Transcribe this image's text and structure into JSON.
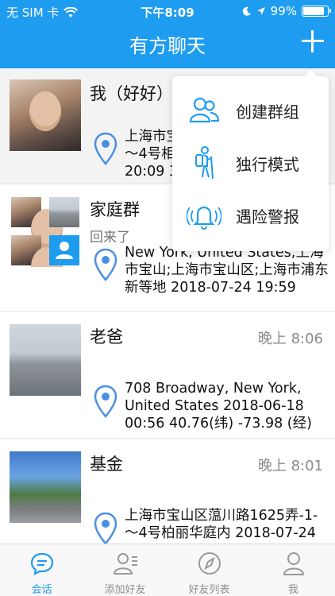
{
  "status_bar": {
    "carrier": "无 SIM 卡",
    "time": "下午8:09",
    "battery": "99%"
  },
  "nav": {
    "title": "有方聊天"
  },
  "menu": {
    "items": [
      {
        "label": "创建群组",
        "icon": "group-icon"
      },
      {
        "label": "独行模式",
        "icon": "hiker-icon"
      },
      {
        "label": "遇险警报",
        "icon": "alarm-bell-icon"
      }
    ]
  },
  "chats": [
    {
      "name": "我（好好）",
      "time": "",
      "subtitle": "",
      "location": "上海市宝\n～4号相\n20:09 3"
    },
    {
      "name": "家庭群",
      "time": "",
      "subtitle": "回来了",
      "location": " New York, United States;上海市宝山;上海市宝山区;上海市浦东新等地 2018-07-24 19:59"
    },
    {
      "name": "老爸",
      "time": "晚上 8:06",
      "subtitle": "",
      "location": "708 Broadway, New York, United States 2018-06-18 00:56 40.76(纬) -73.98 (经)"
    },
    {
      "name": "基金",
      "time": "晚上 8:01",
      "subtitle": "",
      "location": "上海市宝山区蕰川路1625弄-1-～4号柏丽华庭内 2018-07-24"
    }
  ],
  "tabs": [
    {
      "label": "会话",
      "icon": "chat-bubble-icon",
      "active": true
    },
    {
      "label": "添加好友",
      "icon": "add-friend-icon",
      "active": false
    },
    {
      "label": "好友列表",
      "icon": "compass-icon",
      "active": false
    },
    {
      "label": "我",
      "icon": "person-icon",
      "active": false
    }
  ],
  "colors": {
    "accent": "#1e9cf0",
    "pin": "#4a90e2"
  }
}
